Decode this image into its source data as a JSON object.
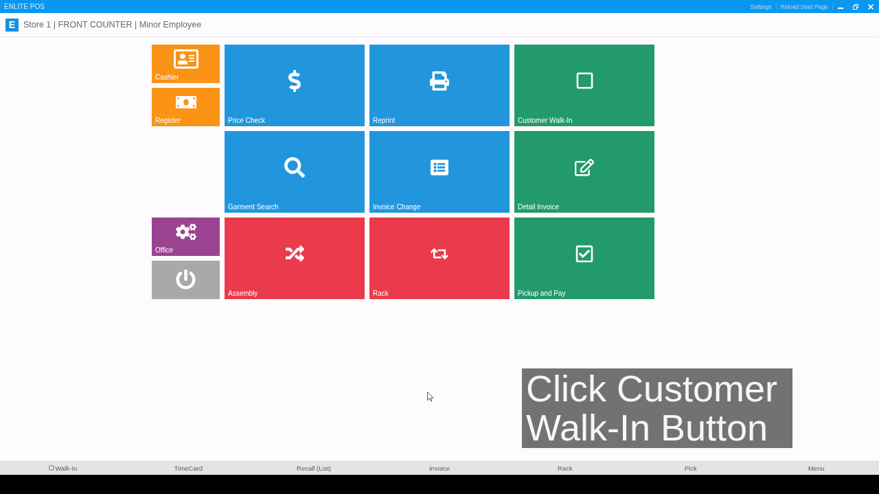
{
  "window": {
    "title": "ENLITE POS",
    "links": [
      "Settings",
      "Reload Start Page"
    ]
  },
  "header": {
    "logo": "E",
    "title": "Store 1 | FRONT COUNTER | Minor Employee"
  },
  "side_tiles": [
    {
      "label": "Cashier",
      "color": "#fa9316"
    },
    {
      "label": "Register",
      "color": "#fa9316"
    },
    {
      "label": "Office",
      "color": "#9a4491"
    },
    {
      "color": "#a9a9a9"
    }
  ],
  "tiles": [
    {
      "label": "Price Check",
      "color": "#2196dd"
    },
    {
      "label": "Reprint",
      "color": "#2196dd"
    },
    {
      "label": "Customer Walk-In",
      "color": "#239a6c"
    },
    {
      "label": "Garment Search",
      "color": "#2196dd"
    },
    {
      "label": "Invoice Change",
      "color": "#2196dd"
    },
    {
      "label": "Detail Invoice",
      "color": "#239a6c"
    },
    {
      "label": "Assembly",
      "color": "#eb3a4c"
    },
    {
      "label": "Rack",
      "color": "#eb3a4c"
    },
    {
      "label": "Pickup and Pay",
      "color": "#239a6c"
    }
  ],
  "caption": "Click Customer Walk-In Button",
  "bottom_bar": [
    {
      "kind": "icon",
      "label": "Walk-In"
    },
    {
      "kind": "text",
      "label": "TimeCard"
    },
    {
      "kind": "text",
      "label": "Recall (List)"
    },
    {
      "kind": "text",
      "label": "Invoice"
    },
    {
      "kind": "text",
      "label": "Rack"
    },
    {
      "kind": "text",
      "label": "Pick"
    },
    {
      "kind": "text",
      "label": "Menu"
    }
  ]
}
